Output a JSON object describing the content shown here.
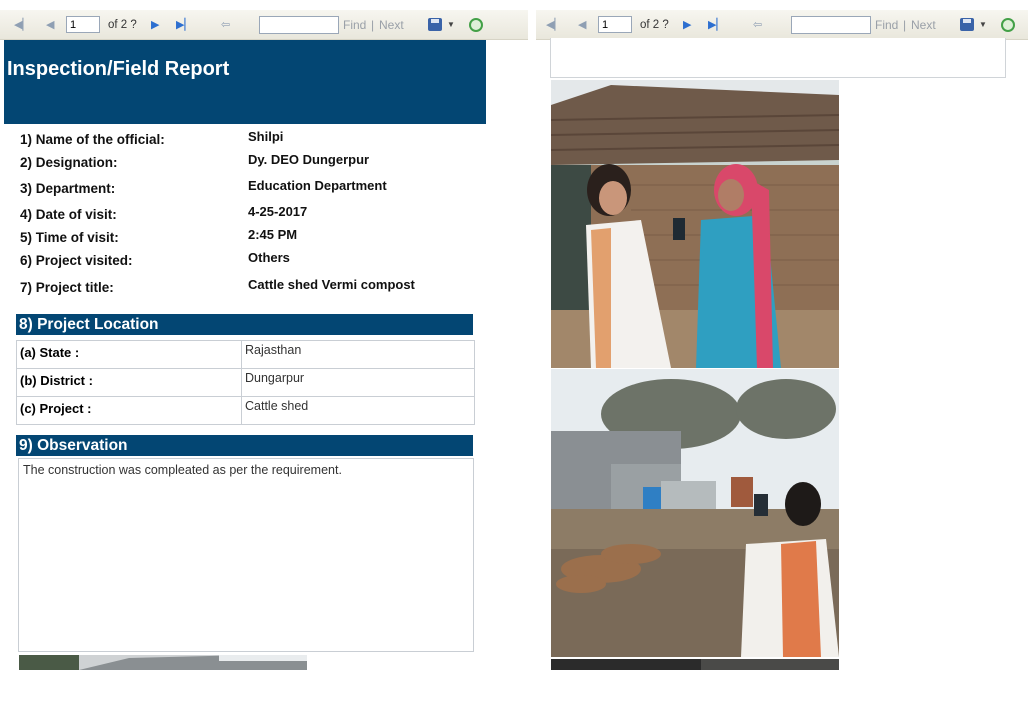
{
  "toolbar": {
    "page_number": "1",
    "page_of": "of 2 ?",
    "find_label": "Find",
    "separator": "|",
    "next_label": "Next",
    "find_placeholder": ""
  },
  "report": {
    "title": "Inspection/Field Report",
    "fields": [
      {
        "label": "1) Name of the official:",
        "value": "Shilpi"
      },
      {
        "label": "2) Designation:",
        "value": "Dy. DEO Dungerpur"
      },
      {
        "label": "3) Department:",
        "value": "Education Department"
      },
      {
        "label": "4) Date of visit:",
        "value": "4-25-2017"
      },
      {
        "label": "5) Time of visit:",
        "value": "2:45 PM"
      },
      {
        "label": "6) Project visited:",
        "value": "Others"
      },
      {
        "label": "7) Project title:",
        "value": "Cattle shed Vermi compost"
      }
    ],
    "location": {
      "heading": "8) Project Location",
      "rows": [
        {
          "key": "(a) State :",
          "value": "Rajasthan"
        },
        {
          "key": "(b) District :",
          "value": "Dungarpur"
        },
        {
          "key": "(c) Project :",
          "value": "Cattle shed"
        }
      ]
    },
    "observation": {
      "heading": "9) Observation",
      "text": "The construction was compleated as per the requirement."
    }
  },
  "icons": {
    "first": "first-page-icon",
    "prev": "previous-page-icon",
    "next": "next-page-icon",
    "last": "last-page-icon",
    "back": "back-icon",
    "save": "save-export-icon",
    "refresh": "refresh-icon"
  },
  "colors": {
    "header_band": "#034673",
    "toolbar_bg": "#ecebe2"
  }
}
